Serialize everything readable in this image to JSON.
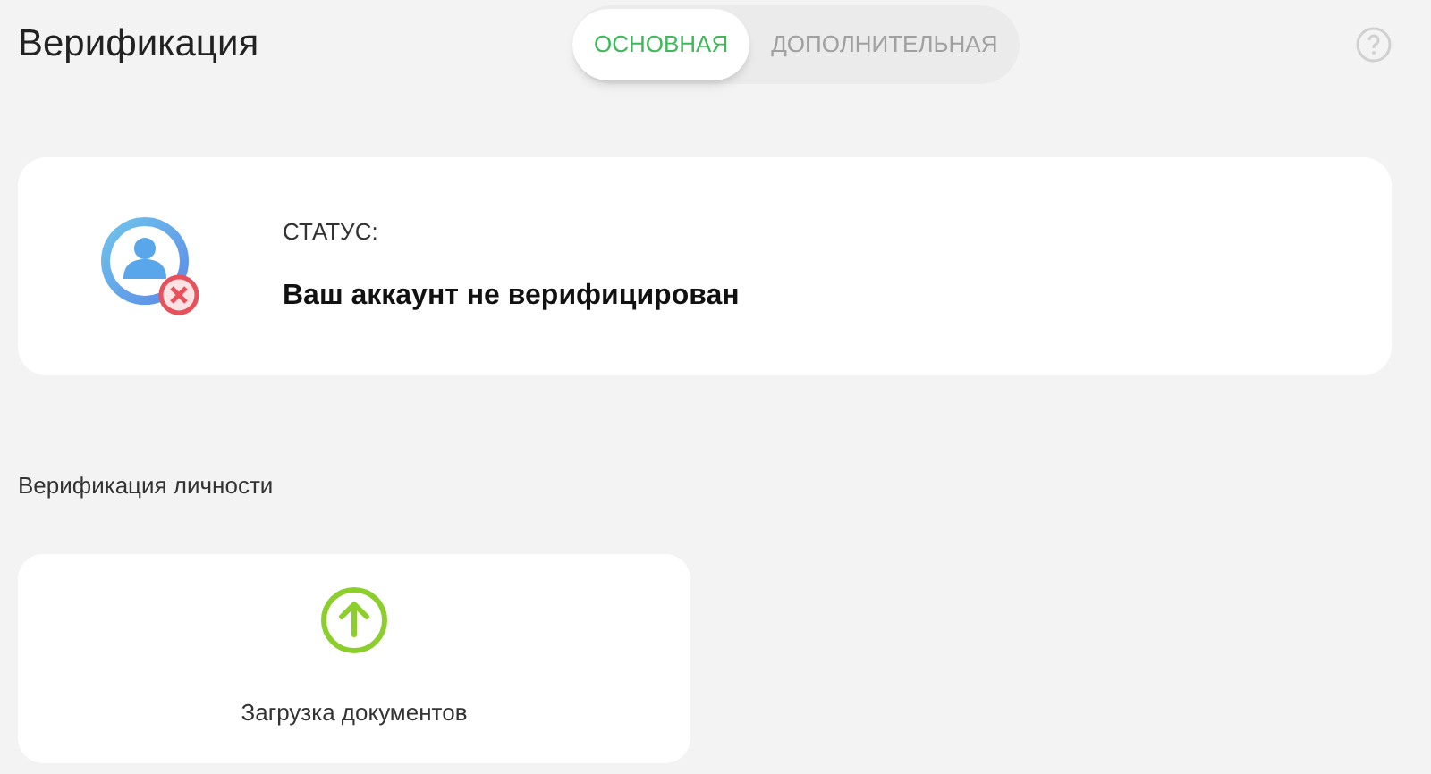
{
  "page": {
    "title": "Верификация"
  },
  "tabs": [
    {
      "label": "ОСНОВНАЯ",
      "selected": true
    },
    {
      "label": "ДОПОЛНИТЕЛЬНАЯ",
      "selected": false
    }
  ],
  "status_card": {
    "label": "СТАТУС:",
    "value": "Ваш аккаунт не верифицирован",
    "verified": false
  },
  "section": {
    "title": "Верификация личности"
  },
  "upload_card": {
    "label": "Загрузка документов"
  }
}
